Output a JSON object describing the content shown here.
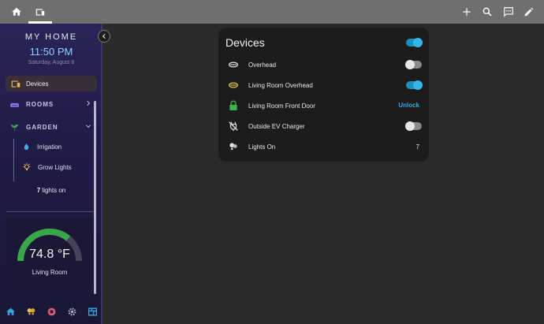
{
  "sidebar": {
    "home_title": "MY HOME",
    "time": "11:50 PM",
    "date": "Saturday, August 8",
    "devices_label": "Devices",
    "rooms_label": "ROOMS",
    "garden_label": "GARDEN",
    "irrigation_label": "Irrigation",
    "grow_lights_label": "Grow Lights",
    "lights_on_count": "7",
    "lights_on_text": " lights on",
    "gauge": {
      "value": "74.8 °F",
      "label": "Living Room",
      "fill_fraction": 0.72,
      "color": "#3aa64a"
    }
  },
  "devices": {
    "title": "Devices",
    "master_toggle": "on",
    "rows": [
      {
        "label": "Overhead",
        "icon": "ceiling-light-icon",
        "state": "off"
      },
      {
        "label": "Living Room Overhead",
        "icon": "ceiling-light-icon",
        "state": "on"
      },
      {
        "label": "Living Room Front Door",
        "icon": "lock-icon",
        "action": "Unlock"
      },
      {
        "label": "Outside EV Charger",
        "icon": "plug-off-icon",
        "state": "off"
      },
      {
        "label": "Lights On",
        "icon": "lightbulbs-icon",
        "value": "7"
      }
    ]
  },
  "colors": {
    "accent": "#37b6ea",
    "lock_green": "#3fb34f",
    "light_on_yellow": "#e7c24a",
    "sidebar_time": "#8fd4ff"
  }
}
